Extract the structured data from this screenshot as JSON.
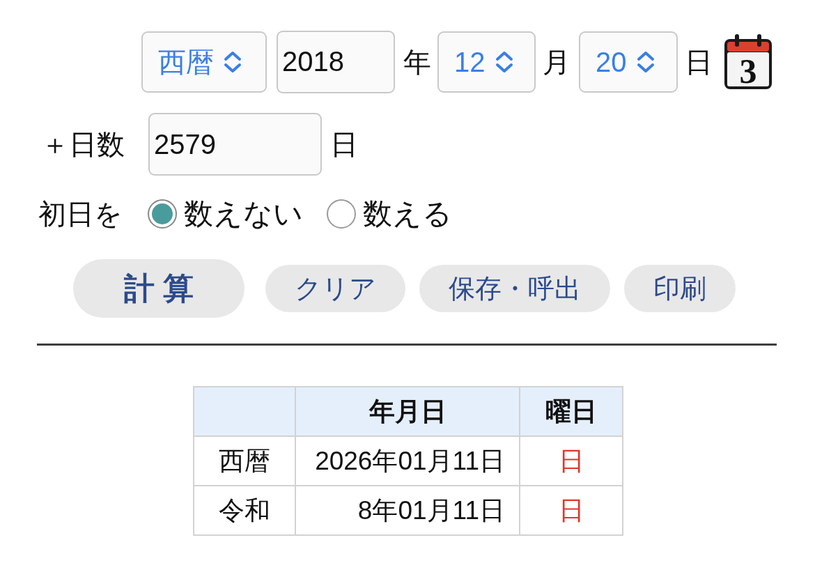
{
  "date_form": {
    "era": {
      "value": "西暦"
    },
    "year": {
      "value": "2018",
      "unit": "年"
    },
    "month": {
      "value": "12",
      "unit": "月"
    },
    "day": {
      "value": "20",
      "unit": "日"
    },
    "calendar_button": {
      "label": "3"
    }
  },
  "days_to_add": {
    "label": "＋日数",
    "value": "2579",
    "unit": "日"
  },
  "first_day": {
    "label": "初日を",
    "options": [
      {
        "label": "数えない",
        "selected": true
      },
      {
        "label": "数える",
        "selected": false
      }
    ]
  },
  "buttons": [
    {
      "label": "計 算",
      "kind": "primary"
    },
    {
      "label": "クリア",
      "kind": "secondary"
    },
    {
      "label": "保存・呼出",
      "kind": "secondary"
    },
    {
      "label": "印刷",
      "kind": "secondary"
    }
  ],
  "result_table": {
    "columns": [
      "年月日",
      "曜日"
    ],
    "rows": [
      {
        "era": "西暦",
        "date": "2026年01月11日",
        "weekday": "日",
        "color": "#e0372c"
      },
      {
        "era": "令和",
        "date": "8年01月11日",
        "weekday": "日",
        "color": "#e0372c"
      }
    ]
  }
}
